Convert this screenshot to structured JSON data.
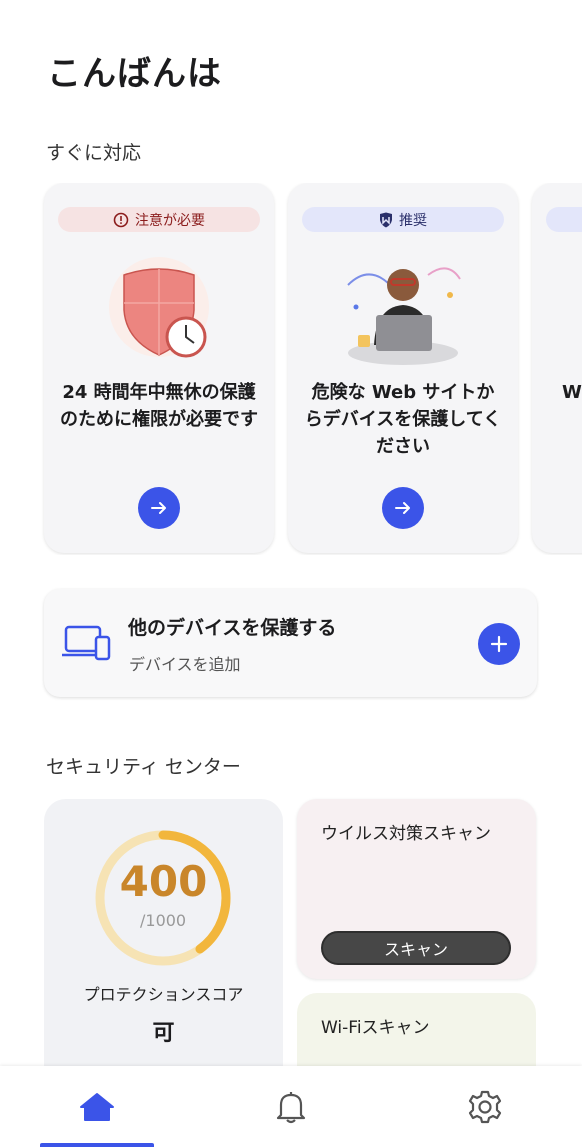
{
  "greeting": "こんばんは",
  "section_now": "すぐに対応",
  "cards": [
    {
      "badge": "注意が必要",
      "badge_icon": "alert-circle-icon",
      "text": "24 時間年中無休の保護のために権限が必要です"
    },
    {
      "badge": "推奨",
      "badge_icon": "shield-logo-icon",
      "text": "危険な Web サイトからデバイスを保護してください"
    },
    {
      "badge": "",
      "text": "W い"
    }
  ],
  "device": {
    "title": "他のデバイスを保護する",
    "subtitle": "デバイスを追加"
  },
  "section_center": "セキュリティ センター",
  "score": {
    "value": "400",
    "max": "/1000",
    "fraction": 0.4,
    "label": "プロテクションスコア",
    "rating": "可"
  },
  "scan": {
    "title": "ウイルス対策スキャン",
    "button": "スキャン"
  },
  "wifi": {
    "title": "Wi-Fiスキャン"
  },
  "nav": {
    "items": [
      "home-icon",
      "bell-icon",
      "gear-icon"
    ],
    "active": "home-icon"
  },
  "colors": {
    "accent": "#3b54e8",
    "score": "#c9862a",
    "warn": "#8b1c1c"
  }
}
